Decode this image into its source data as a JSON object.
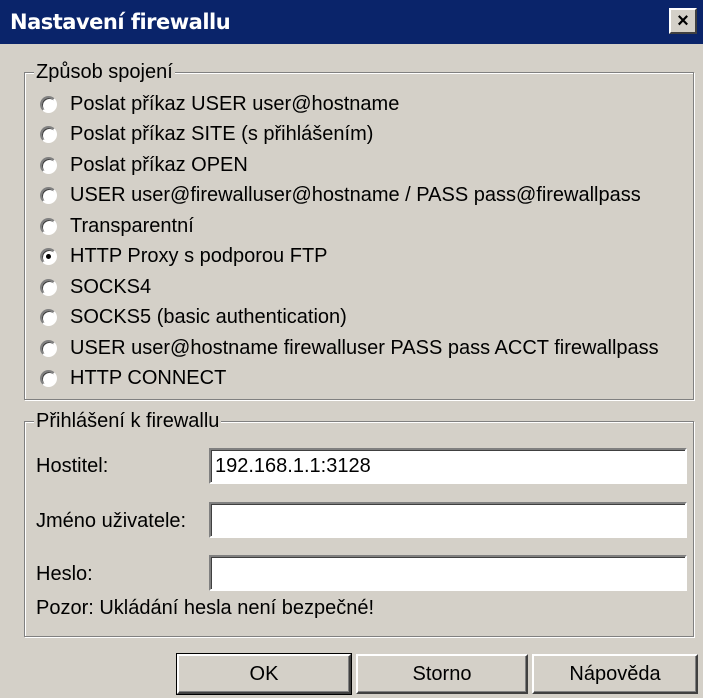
{
  "window": {
    "title": "Nastavení firewallu",
    "close_glyph": "×"
  },
  "connection_group": {
    "label": "Způsob spojení",
    "options": [
      {
        "label": "Poslat příkaz USER user@hostname",
        "checked": false
      },
      {
        "label": "Poslat příkaz SITE (s přihlášením)",
        "checked": false
      },
      {
        "label": "Poslat příkaz OPEN",
        "checked": false
      },
      {
        "label": "USER user@firewalluser@hostname / PASS pass@firewallpass",
        "checked": false
      },
      {
        "label": "Transparentní",
        "checked": false
      },
      {
        "label": "HTTP Proxy s podporou FTP",
        "checked": true
      },
      {
        "label": "SOCKS4",
        "checked": false
      },
      {
        "label": "SOCKS5 (basic authentication)",
        "checked": false
      },
      {
        "label": "USER user@hostname firewalluser PASS pass ACCT firewallpass",
        "checked": false
      },
      {
        "label": "HTTP CONNECT",
        "checked": false
      }
    ]
  },
  "login_group": {
    "label": "Přihlášení k firewallu",
    "host_label": "Hostitel:",
    "host_value": "192.168.1.1:3128",
    "user_label": "Jméno uživatele:",
    "user_value": "",
    "password_label": "Heslo:",
    "password_value": "",
    "warning": "Pozor: Ukládání hesla není bezpečné!"
  },
  "buttons": {
    "ok": "OK",
    "cancel": "Storno",
    "help": "Nápověda"
  }
}
